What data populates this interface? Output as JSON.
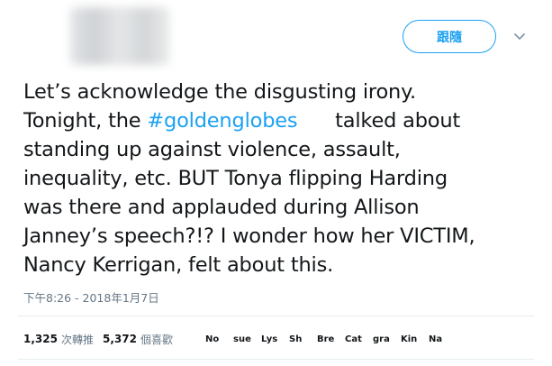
{
  "header": {
    "follow_label": "跟隨",
    "caret_icon": "chevron-down-icon"
  },
  "tweet": {
    "lines": [
      [
        "Let’s acknowledge the disgusting irony."
      ],
      [
        "Tonight, the ",
        "#goldenglobes",
        "      talked about"
      ],
      [
        "standing up against violence, assault,"
      ],
      [
        "inequality, etc. BUT Tonya flipping Harding"
      ],
      [
        "was there and applauded during Allison"
      ],
      [
        "Janney’s speech?!? I wonder how her VICTIM,"
      ],
      [
        "Nancy Kerrigan, felt about this."
      ]
    ],
    "timestamp": "下午8:26 - 2018年1月7日"
  },
  "stats": {
    "retweets_count": "1,325",
    "retweets_label": "次轉推",
    "likes_count": "5,372",
    "likes_label": "個喜歡"
  },
  "likers": [
    "No",
    "sue",
    "Lys",
    "Sh",
    "Bre",
    "Cat",
    "gra",
    "Kin",
    "Na"
  ],
  "colors": {
    "accent": "#1da1f2",
    "text": "#14171a",
    "secondary": "#657786",
    "divider": "#e6ecf0"
  }
}
